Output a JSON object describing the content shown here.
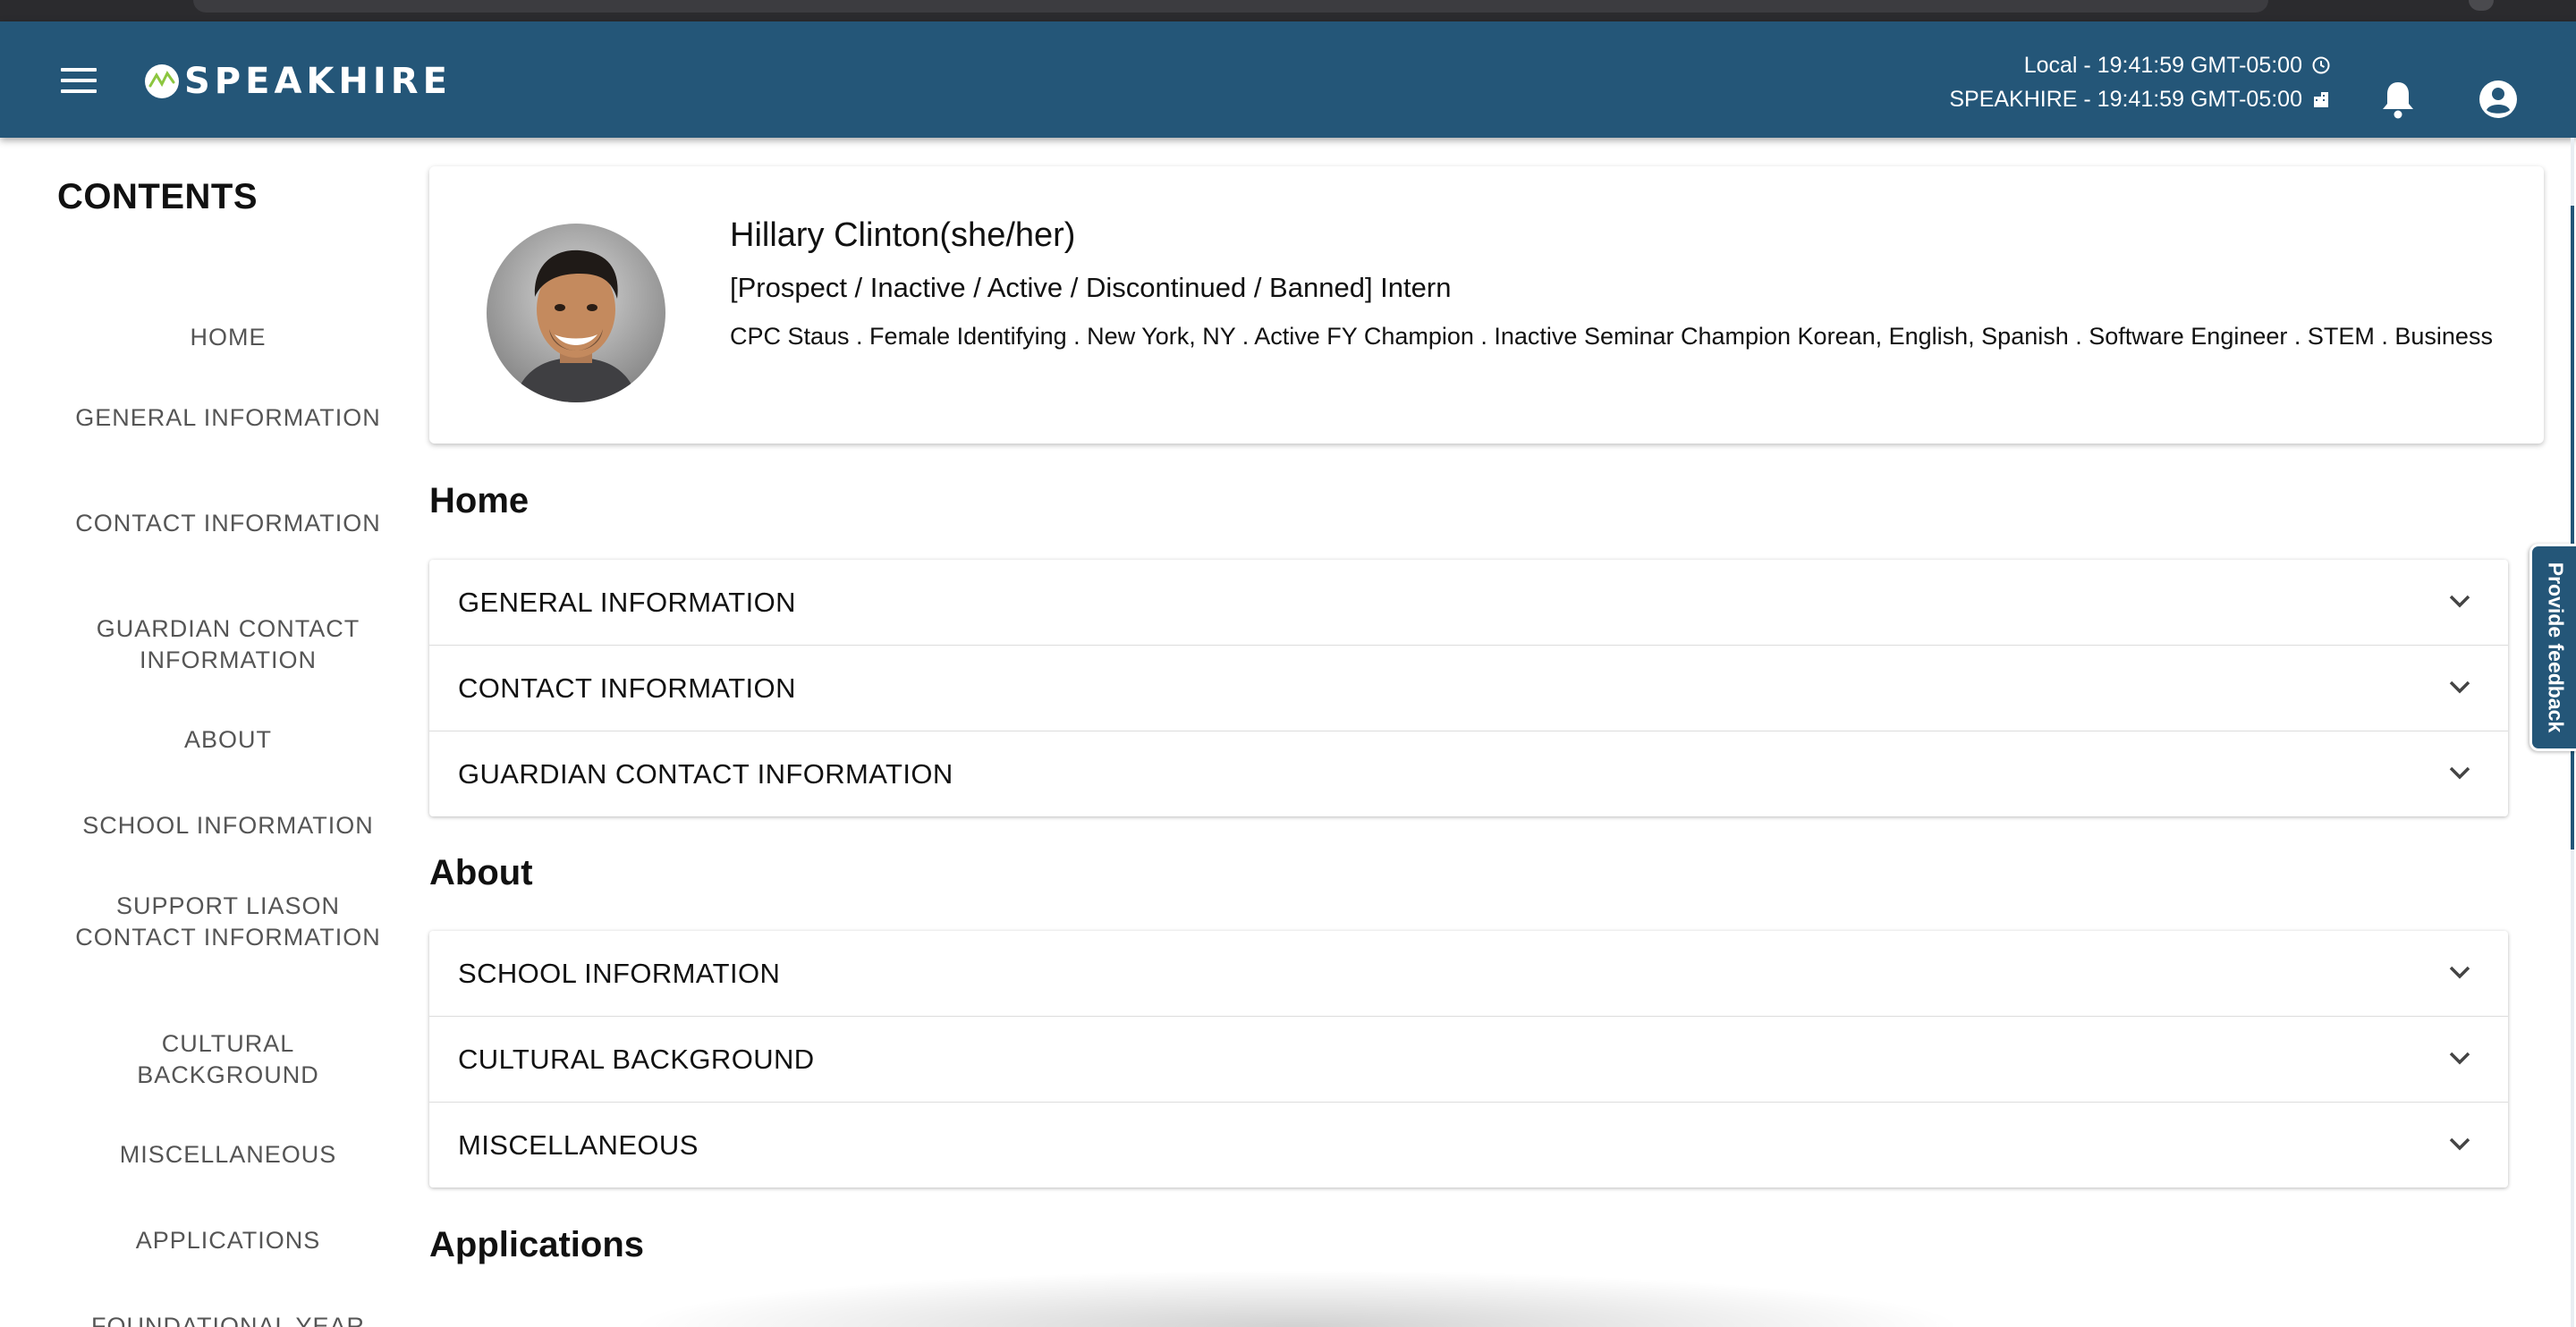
{
  "header": {
    "brand": "SPEAKHIRE",
    "local_time": "Local - 19:41:59 GMT-05:00",
    "org_time": "SPEAKHIRE - 19:41:59 GMT-05:00"
  },
  "sidebar": {
    "title": "CONTENTS",
    "items": [
      "HOME",
      "GENERAL INFORMATION",
      "CONTACT INFORMATION",
      "GUARDIAN CONTACT INFORMATION",
      "ABOUT",
      "SCHOOL INFORMATION",
      "SUPPORT LIASON CONTACT INFORMATION",
      "CULTURAL BACKGROUND",
      "MISCELLANEOUS",
      "APPLICATIONS",
      "FOUNDATIONAL YEAR"
    ]
  },
  "profile": {
    "name": "Hillary Clinton(she/her)",
    "status": "[Prospect / Inactive / Active / Discontinued / Banned] Intern",
    "tags": "CPC Staus . Female Identifying . New York, NY . Active FY Champion . Inactive Seminar Champion Korean, English, Spanish . Software Engineer . STEM . Business"
  },
  "sections": {
    "home": {
      "heading": "Home",
      "panels": [
        "GENERAL INFORMATION",
        "CONTACT INFORMATION",
        "GUARDIAN CONTACT INFORMATION"
      ]
    },
    "about": {
      "heading": "About",
      "panels": [
        "SCHOOL INFORMATION",
        "CULTURAL BACKGROUND",
        "MISCELLANEOUS"
      ]
    },
    "applications": {
      "heading": "Applications"
    }
  },
  "feedback": {
    "label": "Provide feedback"
  },
  "colors": {
    "appbar": "#245678",
    "text": "#111111",
    "toc_text": "#555555"
  }
}
